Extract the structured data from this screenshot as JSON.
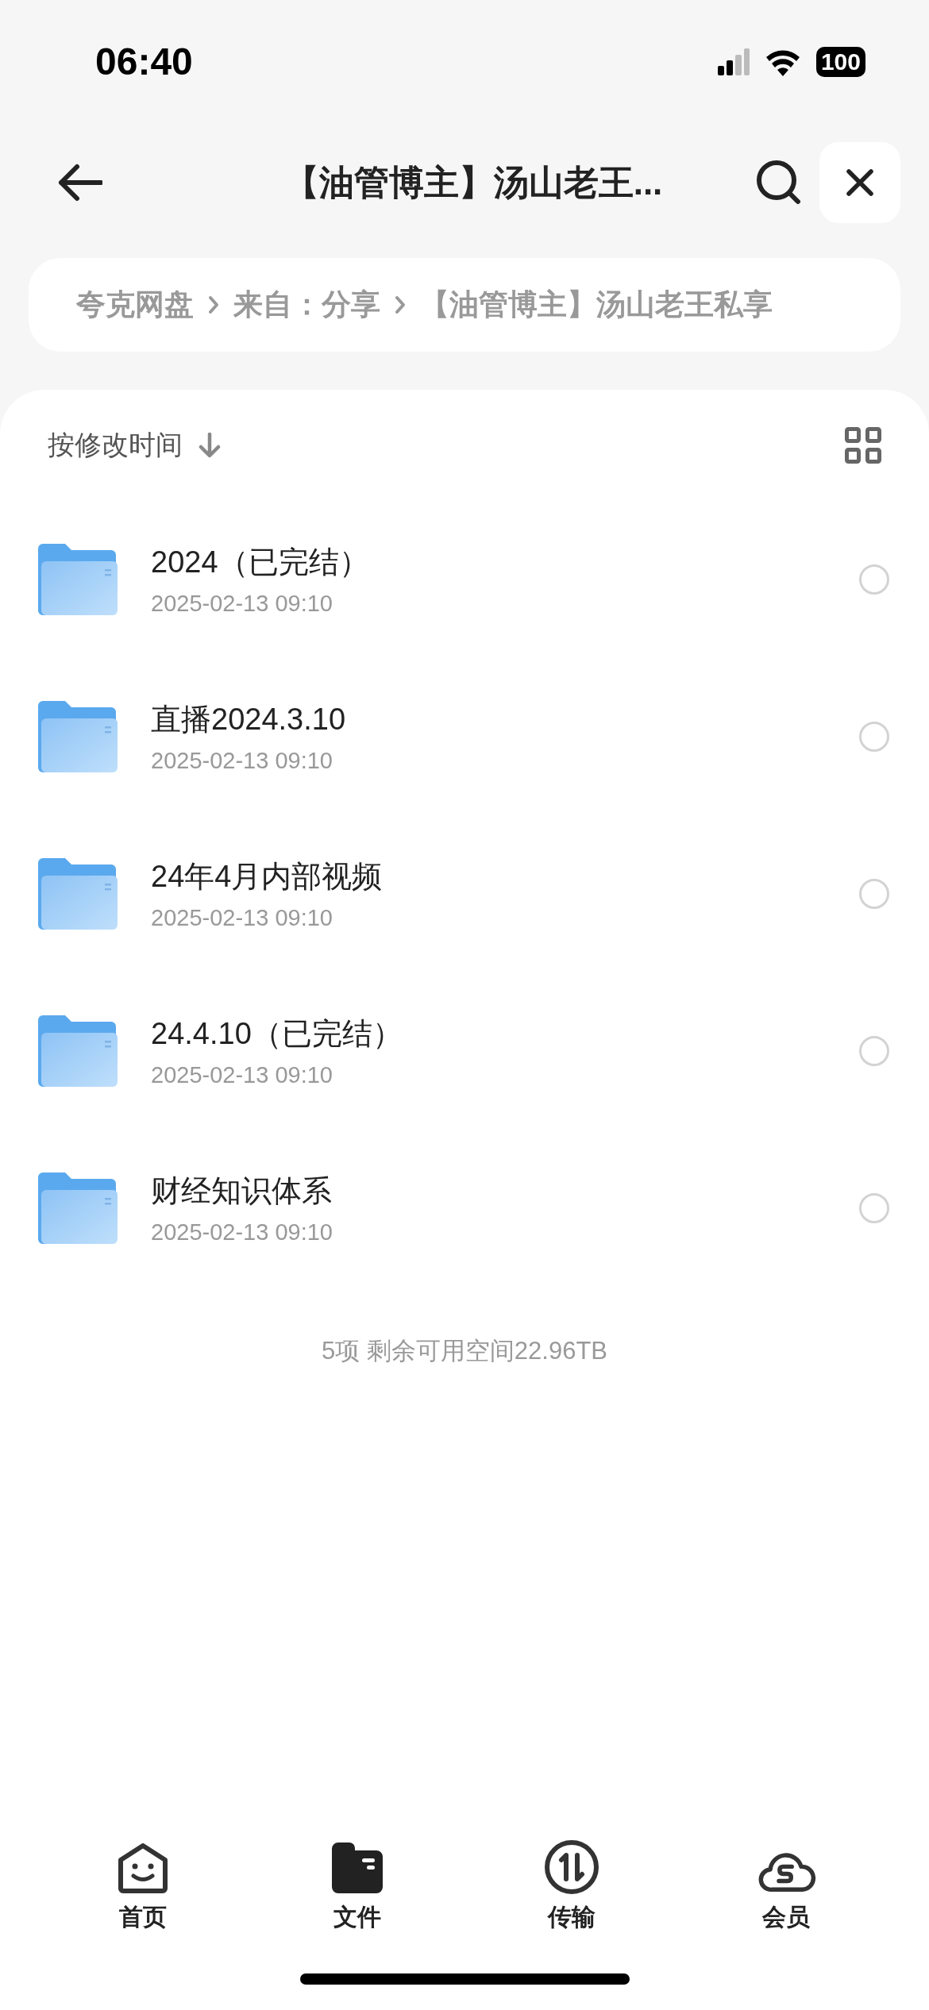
{
  "status_bar": {
    "time": "06:40",
    "battery": "100"
  },
  "header": {
    "title": "【油管博主】汤山老王..."
  },
  "breadcrumb": [
    "夸克网盘",
    "来自：分享",
    "【油管博主】汤山老王私享"
  ],
  "sort": {
    "label": "按修改时间"
  },
  "files": [
    {
      "name": "2024（已完结）",
      "date": "2025-02-13 09:10",
      "selected": false
    },
    {
      "name": "直播2024.3.10",
      "date": "2025-02-13 09:10",
      "selected": false
    },
    {
      "name": "24年4月内部视频",
      "date": "2025-02-13 09:10",
      "selected": false
    },
    {
      "name": "24.4.10（已完结）",
      "date": "2025-02-13 09:10",
      "selected": false
    },
    {
      "name": "财经知识体系",
      "date": "2025-02-13 09:10",
      "selected": false
    }
  ],
  "summary": "5项 剩余可用空间22.96TB",
  "tabs": [
    {
      "kind": "home",
      "label": "首页",
      "selected": false
    },
    {
      "kind": "files",
      "label": "文件",
      "selected": true
    },
    {
      "kind": "transfer",
      "label": "传输",
      "selected": false
    },
    {
      "kind": "member",
      "label": "会员",
      "selected": false
    }
  ]
}
